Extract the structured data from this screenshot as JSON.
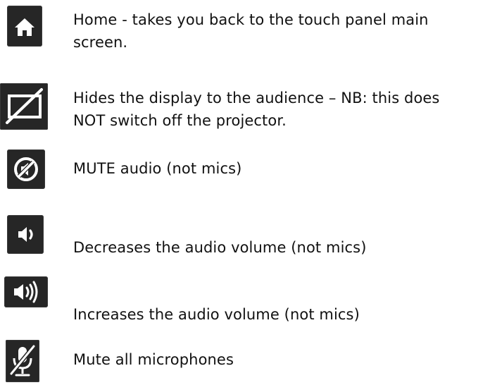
{
  "legend": {
    "items": [
      {
        "icon": "home-icon",
        "text_lines": [
          "Home - takes you back to the touch panel main",
          "screen."
        ]
      },
      {
        "icon": "display-off-icon",
        "text_lines": [
          "Hides the display to the audience – NB: this does",
          "NOT switch off the projector."
        ]
      },
      {
        "icon": "audio-mute-icon",
        "text_lines": [
          "MUTE audio (not mics)"
        ]
      },
      {
        "icon": "volume-down-icon",
        "text_lines": [
          "Decreases the audio volume (not mics)"
        ]
      },
      {
        "icon": "volume-up-icon",
        "text_lines": [
          "Increases the audio volume (not mics)"
        ]
      },
      {
        "icon": "mic-mute-icon",
        "text_lines": [
          "Mute all microphones"
        ]
      }
    ]
  },
  "colors": {
    "icon_background": "#262626",
    "icon_glyph": "#ffffff",
    "text": "#111111"
  }
}
